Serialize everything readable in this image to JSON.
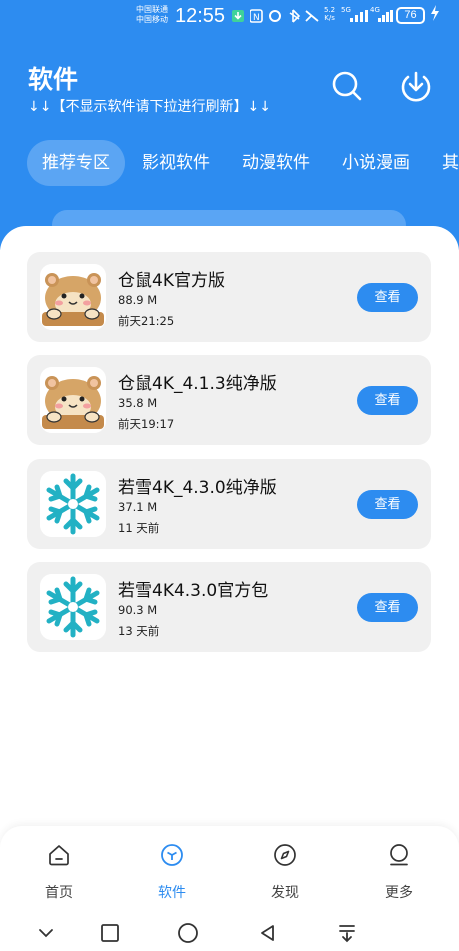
{
  "status_bar": {
    "carrier_line1": "中国联通",
    "carrier_line2": "中国移动",
    "time": "12:55",
    "net_speed_value": "5.2",
    "net_speed_unit": "K/s",
    "signal1": "5G",
    "signal2": "4G",
    "battery": "76"
  },
  "header": {
    "title": "软件",
    "hint": "↓↓【不显示软件请下拉进行刷新】↓↓"
  },
  "tabs": [
    {
      "label": "推荐专区",
      "active": true
    },
    {
      "label": "影视软件",
      "active": false
    },
    {
      "label": "动漫软件",
      "active": false
    },
    {
      "label": "小说漫画",
      "active": false
    },
    {
      "label": "其",
      "active": false
    }
  ],
  "apps": [
    {
      "name": "仓鼠4K官方版",
      "size": "88.9 M",
      "time": "前天21:25",
      "action": "查看",
      "icon": "hamster-icon"
    },
    {
      "name": "仓鼠4K_4.1.3纯净版",
      "size": "35.8 M",
      "time": "前天19:17",
      "action": "查看",
      "icon": "hamster-icon"
    },
    {
      "name": "若雪4K_4.3.0纯净版",
      "size": "37.1 M",
      "time": "11 天前",
      "action": "查看",
      "icon": "snowflake-icon"
    },
    {
      "name": "若雪4K4.3.0官方包",
      "size": "90.3 M",
      "time": "13 天前",
      "action": "查看",
      "icon": "snowflake-icon"
    }
  ],
  "bottom_nav": [
    {
      "label": "首页",
      "icon": "home-icon",
      "active": false
    },
    {
      "label": "软件",
      "icon": "cube-icon",
      "active": true
    },
    {
      "label": "发现",
      "icon": "compass-icon",
      "active": false
    },
    {
      "label": "更多",
      "icon": "person-icon",
      "active": false
    }
  ],
  "colors": {
    "primary": "#2d8cf0",
    "card_bg": "#f0f0f0",
    "snowflake": "#22b1c4"
  }
}
